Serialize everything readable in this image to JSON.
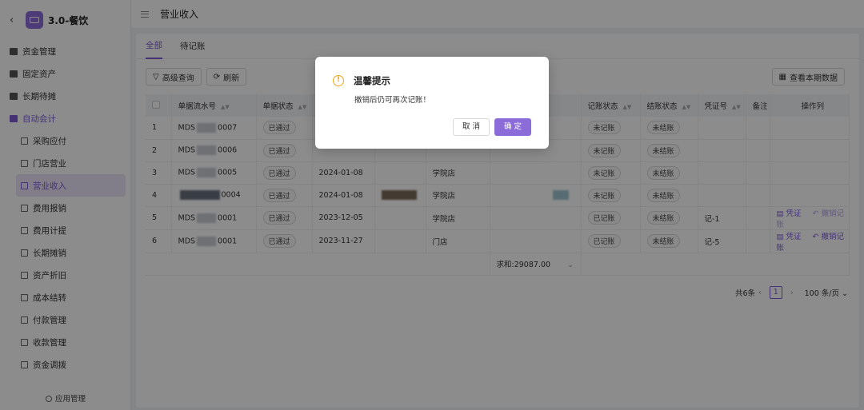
{
  "app": {
    "title": "3.0-餐饮"
  },
  "header": {
    "title": "营业收入"
  },
  "sidebar": {
    "groups": [
      {
        "label": "资金管理"
      },
      {
        "label": "固定资产"
      },
      {
        "label": "长期待摊"
      },
      {
        "label": "自动会计"
      }
    ],
    "subitems": [
      {
        "label": "采购应付"
      },
      {
        "label": "门店营业"
      },
      {
        "label": "营业收入"
      },
      {
        "label": "费用报销"
      },
      {
        "label": "费用计提"
      },
      {
        "label": "长期摊销"
      },
      {
        "label": "资产折旧"
      },
      {
        "label": "成本结转"
      },
      {
        "label": "付款管理"
      },
      {
        "label": "收款管理"
      },
      {
        "label": "资金调拨"
      }
    ],
    "footer": "应用管理"
  },
  "tabs": [
    {
      "label": "全部"
    },
    {
      "label": "待记账"
    }
  ],
  "toolbar": {
    "advanced": "高级查询",
    "refresh": "刷新",
    "view_period": "查看本期数据"
  },
  "table": {
    "columns": [
      "单据流水号",
      "单据状态",
      "记账状态",
      "结账状态",
      "凭证号",
      "备注",
      "操作列"
    ],
    "rows": [
      {
        "idx": "1",
        "serial_a": "MDS",
        "serial_b": "0007",
        "status": "已通过",
        "date": "",
        "store": "",
        "post": "未记账",
        "close": "未结账",
        "voucher": "",
        "act1": "",
        "act2": ""
      },
      {
        "idx": "2",
        "serial_a": "MDS",
        "serial_b": "0006",
        "status": "已通过",
        "date": "",
        "store": "",
        "post": "未记账",
        "close": "未结账",
        "voucher": "",
        "act1": "",
        "act2": ""
      },
      {
        "idx": "3",
        "serial_a": "MDS",
        "serial_b": "0005",
        "status": "已通过",
        "date": "2024-01-08",
        "store": "学院店",
        "post": "未记账",
        "close": "未结账",
        "voucher": "",
        "act1": "",
        "act2": ""
      },
      {
        "idx": "4",
        "serial_a": "",
        "serial_b": "0004",
        "status": "已通过",
        "date": "2024-01-08",
        "store": "学院店",
        "post": "未记账",
        "close": "未结账",
        "voucher": "",
        "act1": "",
        "act2": ""
      },
      {
        "idx": "5",
        "serial_a": "MDS",
        "serial_b": "0001",
        "status": "已通过",
        "date": "2023-12-05",
        "store": "学院店",
        "post": "已记账",
        "close": "未结账",
        "voucher": "记-1",
        "act1": "凭证",
        "act2": "撤销记账"
      },
      {
        "idx": "6",
        "serial_a": "MDS",
        "serial_b": "0001",
        "status": "已通过",
        "date": "2023-11-27",
        "store": "门店",
        "post": "已记账",
        "close": "未结账",
        "voucher": "记-5",
        "act1": "凭证",
        "act2": "撤销记账"
      }
    ],
    "summary": "求和:29087.00"
  },
  "pager": {
    "total": "共6条",
    "page": "1",
    "size": "100 条/页"
  },
  "modal": {
    "title": "温馨提示",
    "message": "撤销后仍可再次记账！",
    "cancel": "取 消",
    "ok": "确 定"
  }
}
